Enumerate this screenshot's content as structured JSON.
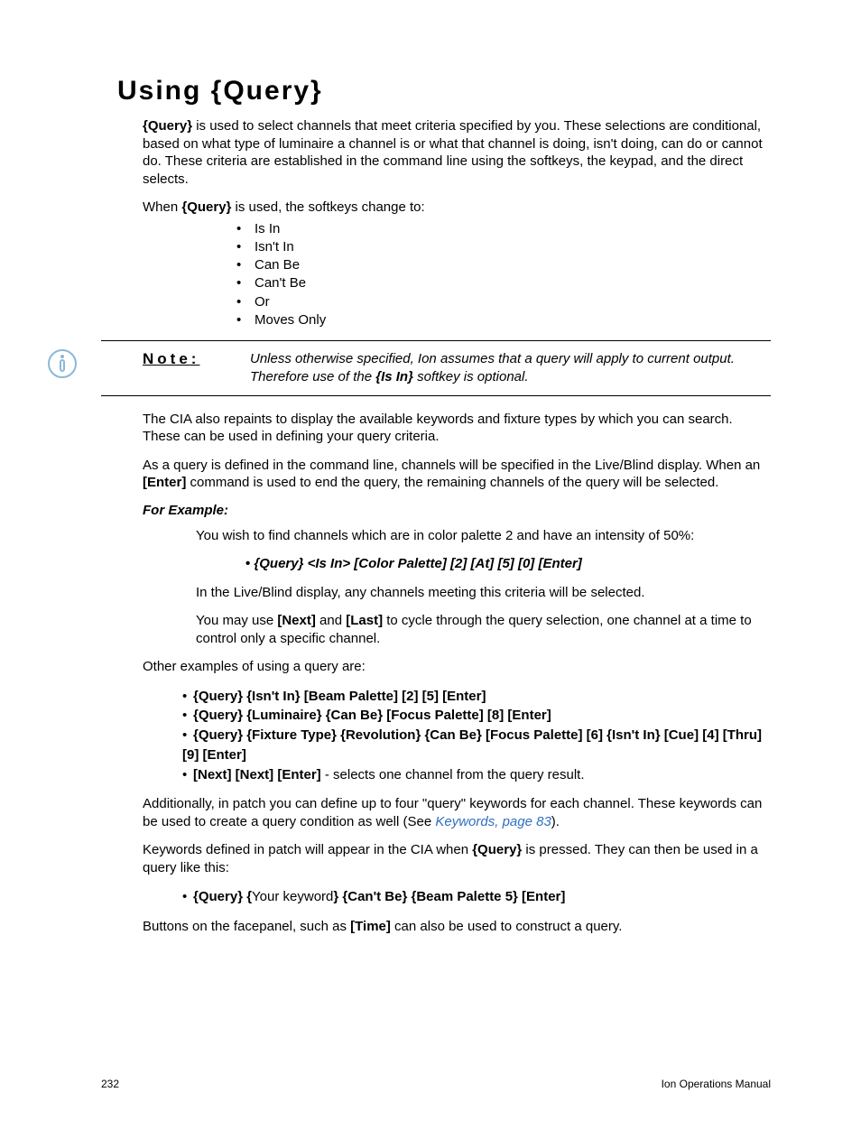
{
  "title": "Using {Query}",
  "p1_a": "{Query}",
  "p1_b": " is used to select channels that meet criteria specified by you. These selections are conditional, based on what type of luminaire a channel is or what that channel is doing, isn't doing, can do or cannot do. These criteria are established in the command line using the softkeys, the keypad, and the direct selects.",
  "p2_a": "When ",
  "p2_b": "{Query}",
  "p2_c": " is used, the softkeys change to:",
  "softkeys": [
    "Is In",
    "Isn't In",
    "Can Be",
    "Can't Be",
    "Or",
    "Moves Only"
  ],
  "note_label": "Note:",
  "note_a": "Unless otherwise specified, Ion assumes that a query will apply to current output. Therefore use of the ",
  "note_b": "{Is In}",
  "note_c": " softkey is optional.",
  "p3": "The CIA also repaints to display the available keywords and fixture types by which you can search. These can be used in defining your query criteria.",
  "p4_a": "As a query is defined in the command line, channels will be specified in the Live/Blind display. When an ",
  "p4_b": "[Enter]",
  "p4_c": " command is used to end the query, the remaining channels of the query will be selected.",
  "for_example": "For Example:",
  "ex_p1": "You wish to find channels which are in color palette 2 and have an intensity of 50%:",
  "ex_cmd": "{Query} <Is In> [Color Palette] [2] [At] [5] [0] [Enter]",
  "ex_p2": "In the Live/Blind display, any channels meeting this criteria will be selected.",
  "ex_p3_a": "You may use ",
  "ex_p3_b": "[Next]",
  "ex_p3_c": " and ",
  "ex_p3_d": "[Last]",
  "ex_p3_e": " to cycle through the query selection, one channel at a time to control only a specific channel.",
  "p5": "Other examples of using a query are:",
  "examples": {
    "0": "{Query} {Isn't In} [Beam Palette] [2] [5] [Enter]",
    "1": "{Query} {Luminaire} {Can Be} [Focus Palette] [8] [Enter]",
    "2": "{Query} {Fixture Type} {Revolution} {Can Be} [Focus Palette] [6] {Isn't In} [Cue] [4] [Thru] [9] [Enter]",
    "3a": "[Next] [Next] [Enter]",
    "3b": " - selects one channel from the query result."
  },
  "p6_a": "Additionally, in patch you can define up to four \"query\" keywords for each channel. These keywords can be used to create a query condition as well (See ",
  "p6_link": "Keywords, page 83",
  "p6_b": ").",
  "p7_a": "Keywords defined in patch will appear in the CIA when ",
  "p7_b": "{Query}",
  "p7_c": " is pressed. They can then be used in a query like this:",
  "kw_ex_a": "{Query} {",
  "kw_ex_b": "Your keyword",
  "kw_ex_c": "} {Can't Be} {Beam Palette 5} [Enter]",
  "p8_a": "Buttons on the facepanel, such as ",
  "p8_b": "[Time]",
  "p8_c": " can also be used to construct a query.",
  "page_number": "232",
  "doc_title": "Ion Operations Manual"
}
